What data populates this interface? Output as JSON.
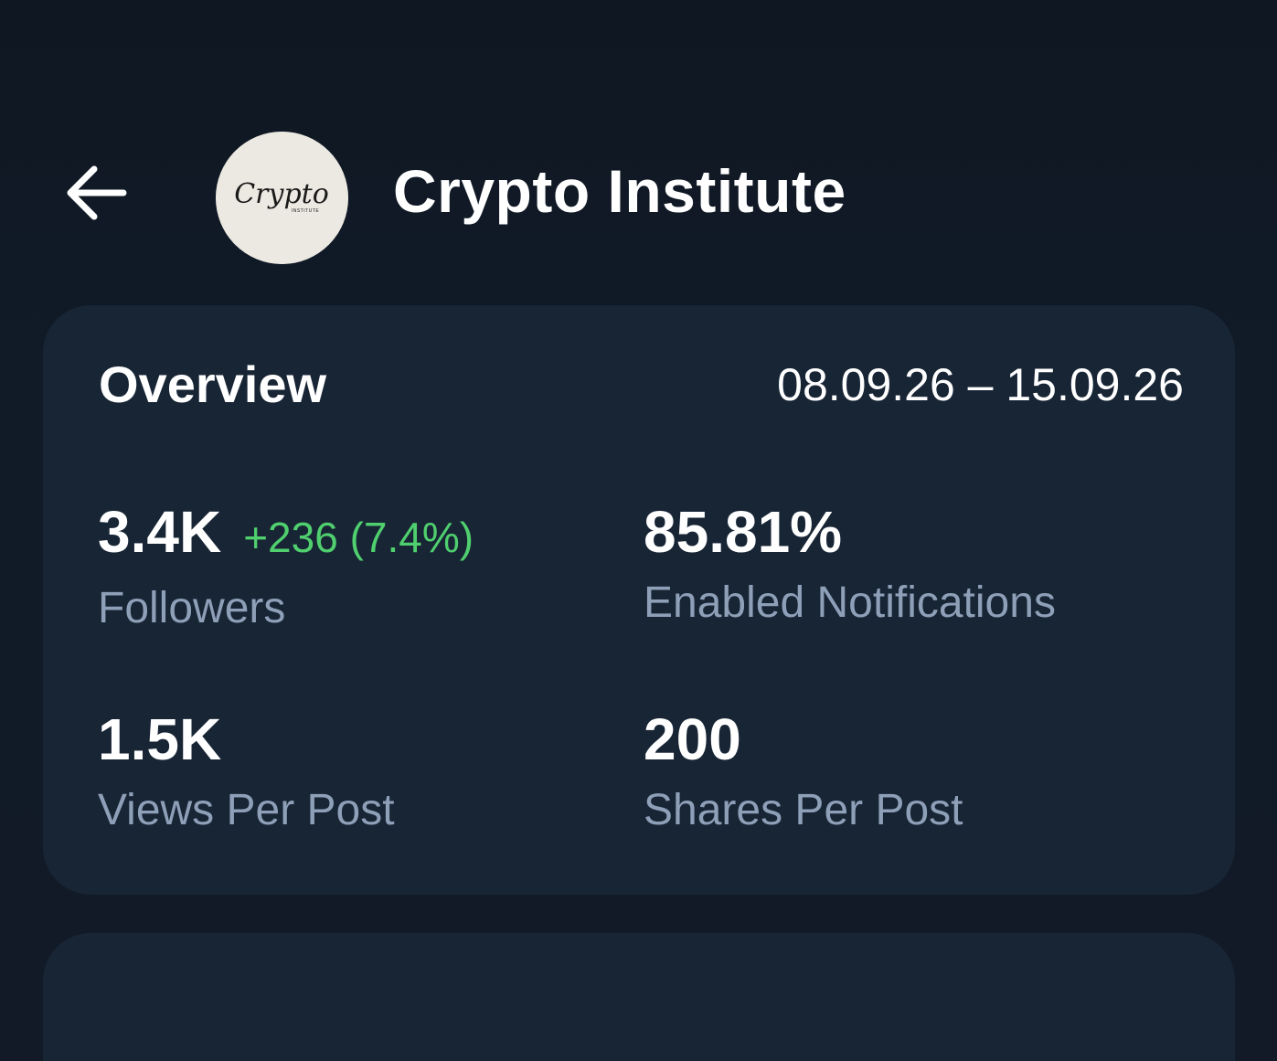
{
  "header": {
    "back_icon": "arrow-left-icon",
    "channel_title": "Crypto Institute",
    "avatar": {
      "logo_text": "Crypto",
      "logo_subtext": "INSTITUTE"
    }
  },
  "overview": {
    "title": "Overview",
    "date_range": "08.09.26 – 15.09.26",
    "stats": {
      "followers": {
        "value": "3.4K",
        "change": "+236 (7.4%)",
        "label": "Followers"
      },
      "notifications": {
        "value": "85.81%",
        "label": "Enabled Notifications"
      },
      "views": {
        "value": "1.5K",
        "label": "Views Per Post"
      },
      "shares": {
        "value": "200",
        "label": "Shares Per Post"
      }
    }
  },
  "colors": {
    "background": "#111a26",
    "card": "#182535",
    "positive": "#4fcf6e",
    "muted_label": "#8e9fb8",
    "text": "#ffffff"
  }
}
